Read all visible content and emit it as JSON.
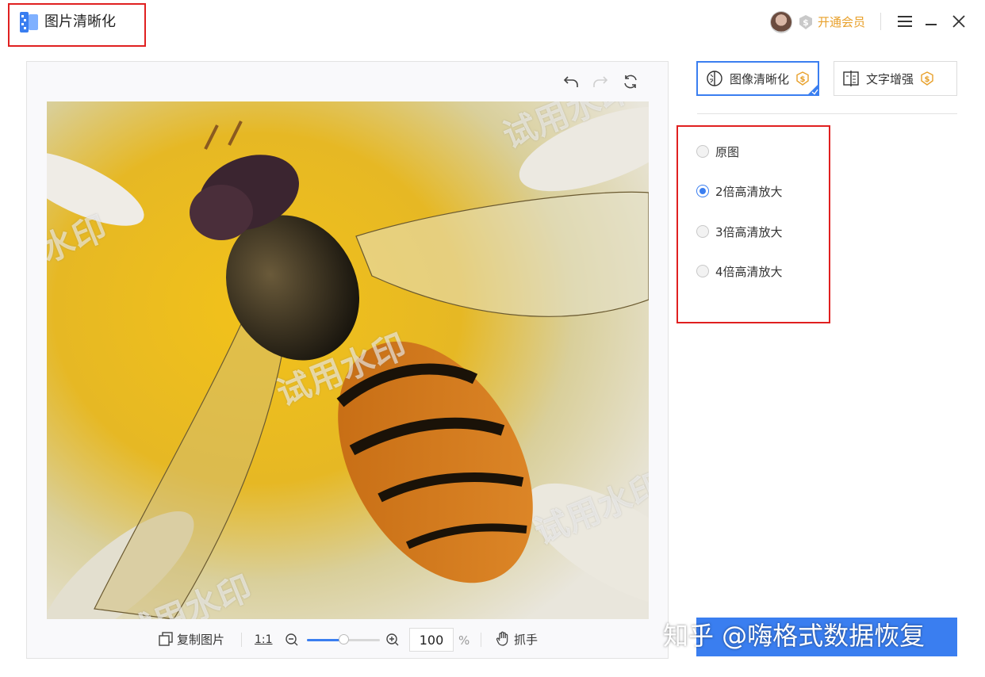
{
  "app": {
    "title": "图片清晰化"
  },
  "header": {
    "vip_label": "开通会员"
  },
  "preview": {
    "watermarks": [
      "试用水印",
      "水印",
      "试用水印",
      "试用水印",
      "试用水印"
    ]
  },
  "bottom_toolbar": {
    "copy_label": "复制图片",
    "ratio_label": "1:1",
    "zoom_value": "100",
    "zoom_unit": "%",
    "zoom_level_percent": 50,
    "pan_label": "抓手"
  },
  "right_panel": {
    "modes": [
      {
        "label": "图像清晰化",
        "active": true
      },
      {
        "label": "文字增强",
        "active": false
      }
    ],
    "options": [
      {
        "label": "原图",
        "checked": false
      },
      {
        "label": "2倍高清放大",
        "checked": true
      },
      {
        "label": "3倍高清放大",
        "checked": false
      },
      {
        "label": "4倍高清放大",
        "checked": false
      }
    ]
  },
  "footer_watermark": "知乎 @嗨格式数据恢复",
  "colors": {
    "accent": "#3a7ef0",
    "highlight": "#e02020",
    "vip": "#e8a02a"
  }
}
